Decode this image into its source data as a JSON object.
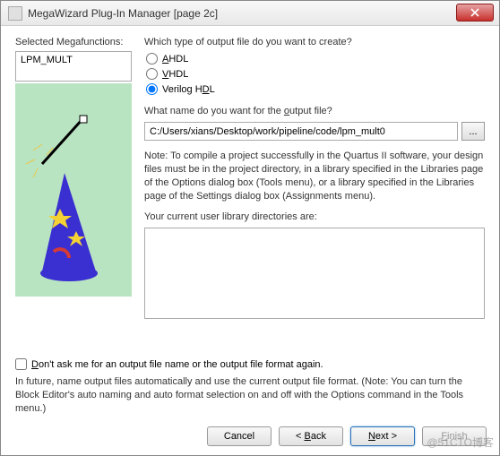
{
  "window": {
    "title": "MegaWizard Plug-In Manager [page 2c]"
  },
  "left": {
    "label": "Selected Megafunctions:",
    "selected": "LPM_MULT"
  },
  "output_type": {
    "question": "Which type of output file do you want to create?",
    "ahdl": "AHDL",
    "vhdl": "VHDL",
    "verilog": "Verilog HDL"
  },
  "output_name": {
    "question": "What name do you want for the output file?",
    "path": "C:/Users/xians/Desktop/work/pipeline/code/lpm_mult0",
    "browse": "..."
  },
  "note": "Note: To compile a project successfully in the Quartus II software, your design files must be in the project directory, in a library specified in the Libraries page of the Options dialog box (Tools menu), or a library specified in the Libraries page of the Settings dialog box (Assignments menu).",
  "dirs_label": "Your current user library directories are:",
  "dont_ask": "Don't ask me for an output file name or the output file format again.",
  "future": "In future, name output files automatically and use the current output file format. (Note: You can turn the Block Editor's auto naming and auto format selection on and off with the Options command in the Tools menu.)",
  "buttons": {
    "cancel": "Cancel",
    "back": "< Back",
    "next": "Next >",
    "finish": "Finish"
  },
  "watermark": "@51CTO博客"
}
